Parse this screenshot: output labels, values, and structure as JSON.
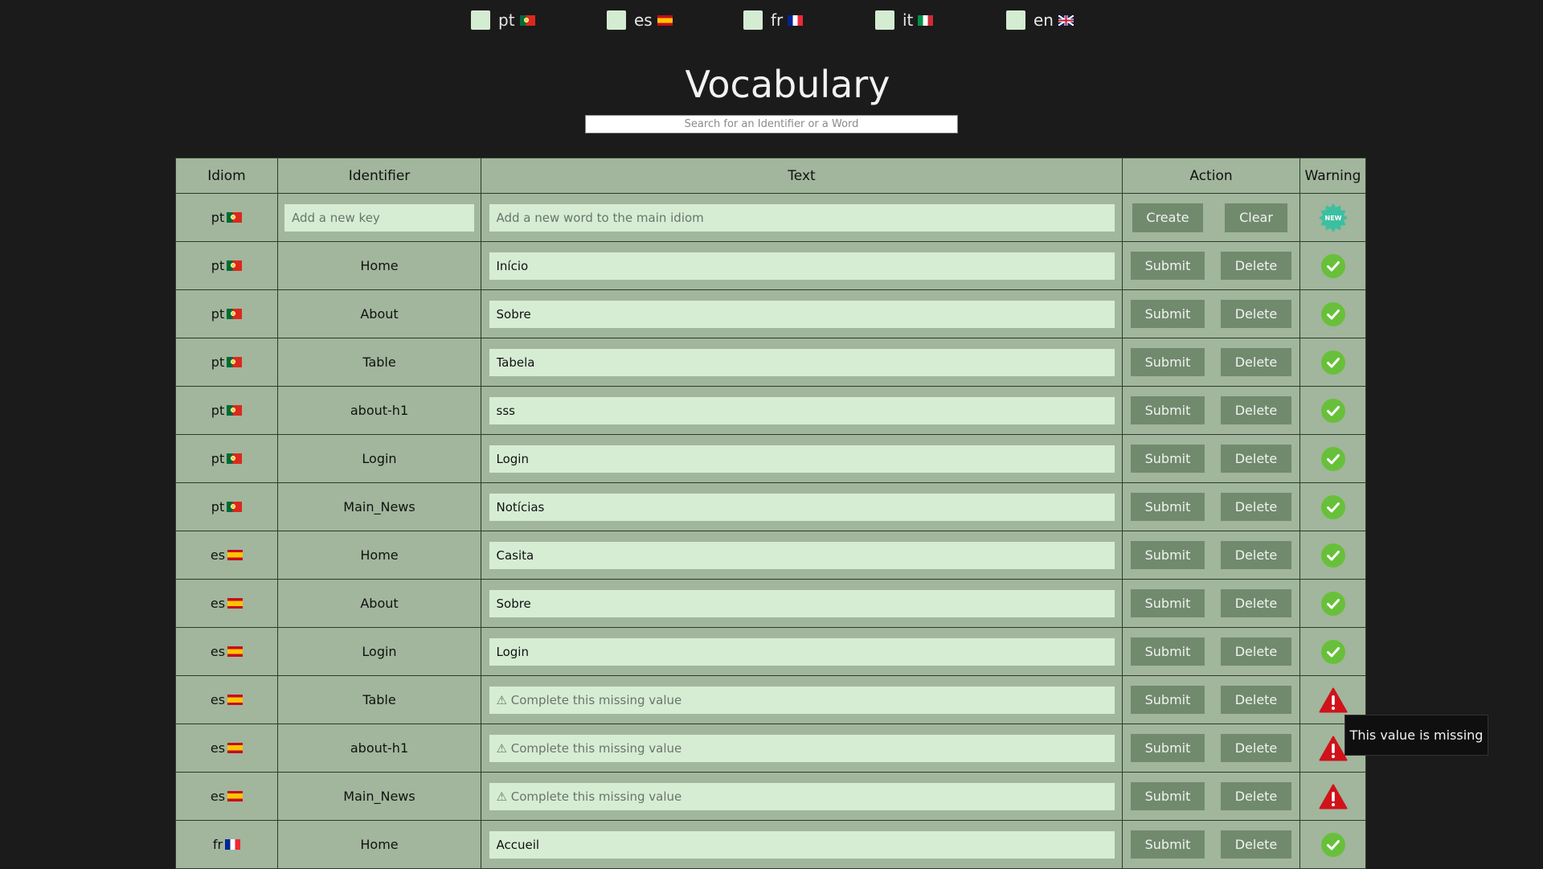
{
  "languages": [
    {
      "code": "pt",
      "flag": "portugal-flag-icon"
    },
    {
      "code": "es",
      "flag": "spain-flag-icon"
    },
    {
      "code": "fr",
      "flag": "france-flag-icon"
    },
    {
      "code": "it",
      "flag": "italy-flag-icon"
    },
    {
      "code": "en",
      "flag": "uk-flag-icon"
    }
  ],
  "title": "Vocabulary",
  "search": {
    "placeholder": "Search for an Identifier or a Word"
  },
  "table": {
    "headers": {
      "idiom": "Idiom",
      "identifier": "Identifier",
      "text": "Text",
      "action": "Action",
      "warning": "Warning"
    },
    "new_row": {
      "idiom": "pt",
      "key_placeholder": "Add a new key",
      "word_placeholder": "Add a new word to the main idiom",
      "create_label": "Create",
      "clear_label": "Clear",
      "badge_text": "NEW"
    },
    "submit_label": "Submit",
    "delete_label": "Delete",
    "missing_placeholder": "⚠ Complete this missing value",
    "rows": [
      {
        "idiom": "pt",
        "identifier": "Home",
        "text": "Início",
        "status": "ok"
      },
      {
        "idiom": "pt",
        "identifier": "About",
        "text": "Sobre",
        "status": "ok"
      },
      {
        "idiom": "pt",
        "identifier": "Table",
        "text": "Tabela",
        "status": "ok"
      },
      {
        "idiom": "pt",
        "identifier": "about-h1",
        "text": "sss",
        "status": "ok"
      },
      {
        "idiom": "pt",
        "identifier": "Login",
        "text": "Login",
        "status": "ok"
      },
      {
        "idiom": "pt",
        "identifier": "Main_News",
        "text": "Notícias",
        "status": "ok"
      },
      {
        "idiom": "es",
        "identifier": "Home",
        "text": "Casita",
        "status": "ok"
      },
      {
        "idiom": "es",
        "identifier": "About",
        "text": "Sobre",
        "status": "ok"
      },
      {
        "idiom": "es",
        "identifier": "Login",
        "text": "Login",
        "status": "ok"
      },
      {
        "idiom": "es",
        "identifier": "Table",
        "text": "",
        "status": "missing"
      },
      {
        "idiom": "es",
        "identifier": "about-h1",
        "text": "",
        "status": "missing"
      },
      {
        "idiom": "es",
        "identifier": "Main_News",
        "text": "",
        "status": "missing"
      },
      {
        "idiom": "fr",
        "identifier": "Home",
        "text": "Accueil",
        "status": "ok"
      }
    ]
  },
  "tooltip": "This value is missing",
  "colors": {
    "background": "#1b1b1b",
    "table": "#a1b69c",
    "input": "#d6edd4",
    "button": "#718a6e",
    "ok": "#68c03a",
    "warning": "#d0121b",
    "new_badge": "#3cbfa0"
  }
}
